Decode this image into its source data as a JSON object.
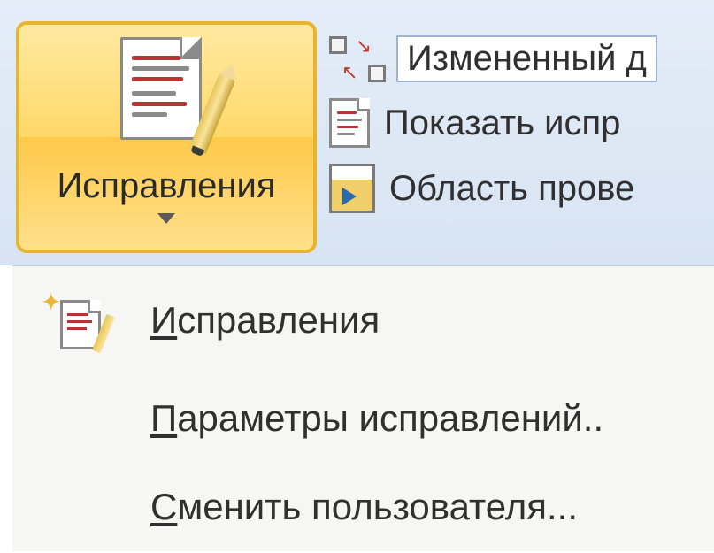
{
  "ribbon": {
    "track_changes_button": "Исправления",
    "display_for_review": "Измененный д",
    "show_markup": "Показать испр",
    "reviewing_pane": "Область прове"
  },
  "dropdown": {
    "item_track_changes": {
      "underline": "И",
      "rest": "справления"
    },
    "item_options": {
      "underline": "П",
      "rest": "араметры исправлений.."
    },
    "item_change_user": {
      "underline": "С",
      "rest": "менить пользователя..."
    }
  }
}
